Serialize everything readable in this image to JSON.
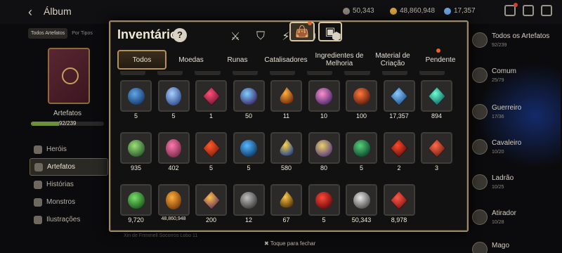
{
  "background": {
    "title": "Álbum",
    "currencies": [
      {
        "value": "50,343",
        "color": "#cfc8b8"
      },
      {
        "value": "48,860,948",
        "color": "#d9a63a"
      },
      {
        "value": "17,357",
        "color": "#6aa7e0"
      }
    ],
    "left": {
      "tabs": [
        "Todos Artefatos",
        "Por Tipos"
      ],
      "label": "Artefatos",
      "count": "92/239",
      "progress": 0.38,
      "nav": [
        "Heróis",
        "Artefatos",
        "Histórias",
        "Monstros",
        "Ilustrações"
      ]
    },
    "right": [
      {
        "label": "Todos os Artefatos",
        "sub": "92/239"
      },
      {
        "label": "Comum",
        "sub": "25/79"
      },
      {
        "label": "Guerreiro",
        "sub": "17/36"
      },
      {
        "label": "Cavaleiro",
        "sub": "10/20"
      },
      {
        "label": "Ladrão",
        "sub": "10/25"
      },
      {
        "label": "Atirador",
        "sub": "10/28"
      },
      {
        "label": "Mago",
        "sub": ""
      }
    ],
    "bottom_ghost": "Xin de Frimmell Socorros      Lobo 11",
    "close_hint": "✖ Toque para fechar"
  },
  "modal": {
    "title": "Inventário",
    "help": "?",
    "category_icons": [
      "weapon-icon",
      "shield-icon",
      "lightning-icon",
      "cross-icon",
      "cube-icon",
      "bag-icon",
      "chest-icon"
    ],
    "tabs": [
      "Todos",
      "Moedas",
      "Runas",
      "Catalisadores",
      "Ingredientes de Melhoria",
      "Material de Criação",
      "Pendente"
    ],
    "items": [
      {
        "q": "5",
        "c1": "#5fa8e8",
        "c2": "#163a6e"
      },
      {
        "q": "5",
        "c1": "#a8d0ff",
        "c2": "#2f4f8f"
      },
      {
        "q": "1",
        "c1": "#ff4f7a",
        "c2": "#6a102a"
      },
      {
        "q": "50",
        "c1": "#7fd0ff",
        "c2": "#3a2a6a"
      },
      {
        "q": "11",
        "c1": "#ffb03a",
        "c2": "#7a3010"
      },
      {
        "q": "10",
        "c1": "#ff8fd0",
        "c2": "#4a2a6a"
      },
      {
        "q": "100",
        "c1": "#ff7a3a",
        "c2": "#5a1a10"
      },
      {
        "q": "17,357",
        "c1": "#8ac8ff",
        "c2": "#1a4a8a"
      },
      {
        "q": "894",
        "c1": "#6affd0",
        "c2": "#0a5a5a"
      },
      {
        "q": "935",
        "c1": "#9ee07a",
        "c2": "#2a5a2a"
      },
      {
        "q": "402",
        "c1": "#ff7ab0",
        "c2": "#7a2a4a"
      },
      {
        "q": "5",
        "c1": "#ff5a2a",
        "c2": "#7a1a0a"
      },
      {
        "q": "5",
        "c1": "#5ab8ff",
        "c2": "#0a3a6a"
      },
      {
        "q": "580",
        "c1": "#ffd24a",
        "c2": "#2a4a8a"
      },
      {
        "q": "80",
        "c1": "#e8d26a",
        "c2": "#5a3a7a"
      },
      {
        "q": "5",
        "c1": "#5ad07a",
        "c2": "#0a4a2a"
      },
      {
        "q": "2",
        "c1": "#ff4a2a",
        "c2": "#5a0a0a"
      },
      {
        "q": "3",
        "c1": "#ff6a4a",
        "c2": "#6a1a10"
      },
      {
        "q": "9,720",
        "c1": "#7ae06a",
        "c2": "#1a5a1a"
      },
      {
        "q": "48,860,948",
        "c1": "#ffb03a",
        "c2": "#7a3a0a"
      },
      {
        "q": "200",
        "c1": "#ffc04a",
        "c2": "#5a2a5a"
      },
      {
        "q": "12",
        "c1": "#c0c0c0",
        "c2": "#3a3a3a"
      },
      {
        "q": "67",
        "c1": "#ffc84a",
        "c2": "#5a3a0a"
      },
      {
        "q": "5",
        "c1": "#ff4a3a",
        "c2": "#6a0a0a"
      },
      {
        "q": "50,343",
        "c1": "#e8e8e8",
        "c2": "#4a4a4a"
      },
      {
        "q": "8,978",
        "c1": "#ff5a4a",
        "c2": "#7a1010"
      }
    ]
  }
}
